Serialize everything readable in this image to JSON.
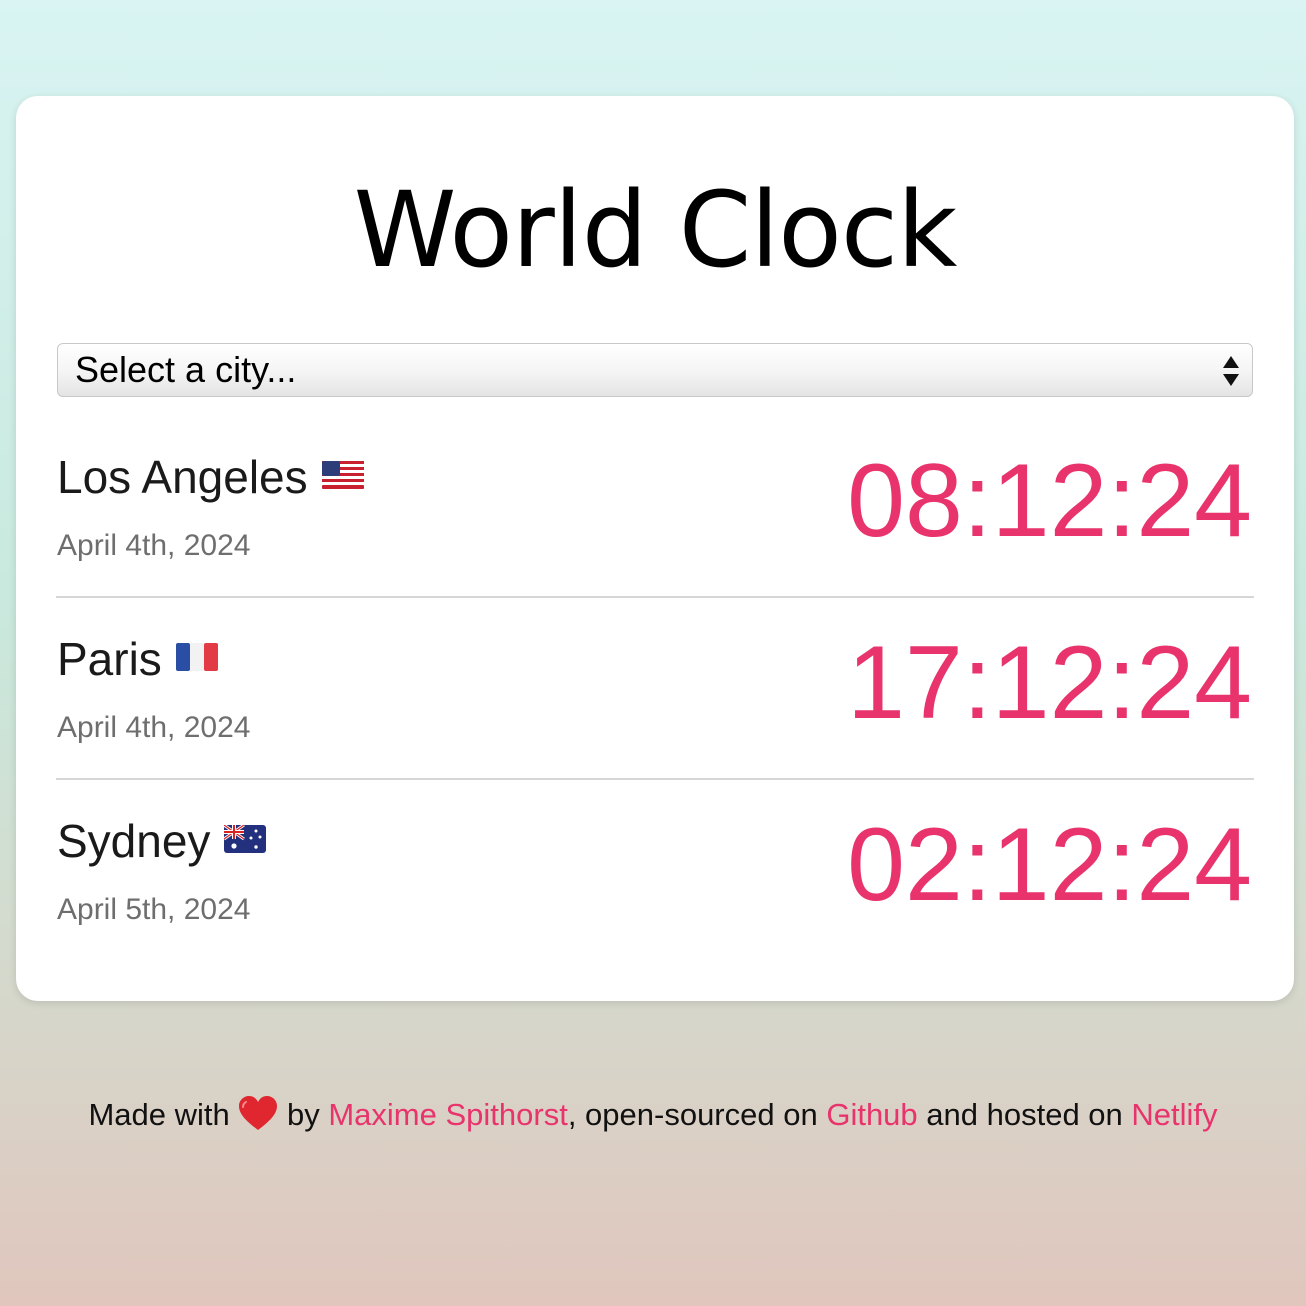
{
  "app": {
    "title": "World Clock"
  },
  "city_select": {
    "selected": "Select a city..."
  },
  "cities": [
    {
      "name": "Los Angeles",
      "flag": "us-flag-icon",
      "date": "April 4th, 2024",
      "time": "08:12:24"
    },
    {
      "name": "Paris",
      "flag": "fr-flag-icon",
      "date": "April 4th, 2024",
      "time": "17:12:24"
    },
    {
      "name": "Sydney",
      "flag": "au-flag-icon",
      "date": "April 5th, 2024",
      "time": "02:12:24"
    }
  ],
  "footer": {
    "made_with": "Made with",
    "by": " by ",
    "author": "Maxime Spithorst",
    "open_sourced": ", open-sourced on ",
    "github": "Github",
    "hosted": " and hosted on ",
    "netlify": "Netlify"
  },
  "colors": {
    "accent": "#e8336c",
    "heart": "#e0262f"
  }
}
